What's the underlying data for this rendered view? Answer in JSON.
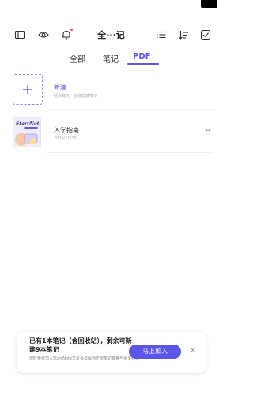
{
  "header": {
    "title": "全···记"
  },
  "tabs": [
    {
      "label": "全部"
    },
    {
      "label": "笔记"
    },
    {
      "label": "PDF"
    }
  ],
  "list": {
    "new_item": {
      "title": "新建",
      "subtitle": "轻点两下，创建快捷笔记"
    },
    "items": [
      {
        "title": "入学指南",
        "date": "2024/10/30"
      }
    ]
  },
  "banner": {
    "message": "已有1本笔记（含回收站），剩余可新建9本笔记",
    "note": "限时免费加入StarrNote文星会员解锁无限笔记数量与更多权益",
    "button_label": "马上加入"
  },
  "colors": {
    "accent": "#5c56e8",
    "notification_dot": "#f05050"
  }
}
